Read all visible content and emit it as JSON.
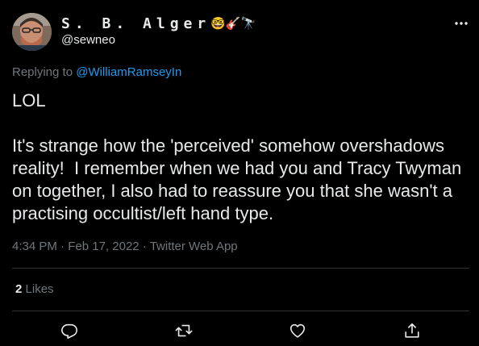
{
  "author": {
    "display_name": "S. B. Alger",
    "emojis": "🤓🎸🔭",
    "handle": "@sewneo"
  },
  "reply_context": {
    "prefix": "Replying to",
    "mention": "@WilliamRamseyIn"
  },
  "tweet": {
    "text": "LOL\n\nIt's strange how the 'perceived' somehow overshadows reality!  I remember when we had you and Tracy Twyman on together, I also had to reassure you that she wasn't a practising occultist/left hand type."
  },
  "meta": {
    "time": "4:34 PM",
    "separator": "·",
    "date": "Feb 17, 2022",
    "source": "Twitter Web App"
  },
  "stats": {
    "likes_count": "2",
    "likes_label": "Likes"
  },
  "icons": {
    "more": "more-icon",
    "reply": "reply-icon",
    "retweet": "retweet-icon",
    "like": "heart-icon",
    "share": "share-icon"
  },
  "colors": {
    "background": "#000000",
    "text": "#e7e9ea",
    "secondary": "#71767b",
    "link": "#1d9bf0",
    "divider": "#2f3336"
  }
}
